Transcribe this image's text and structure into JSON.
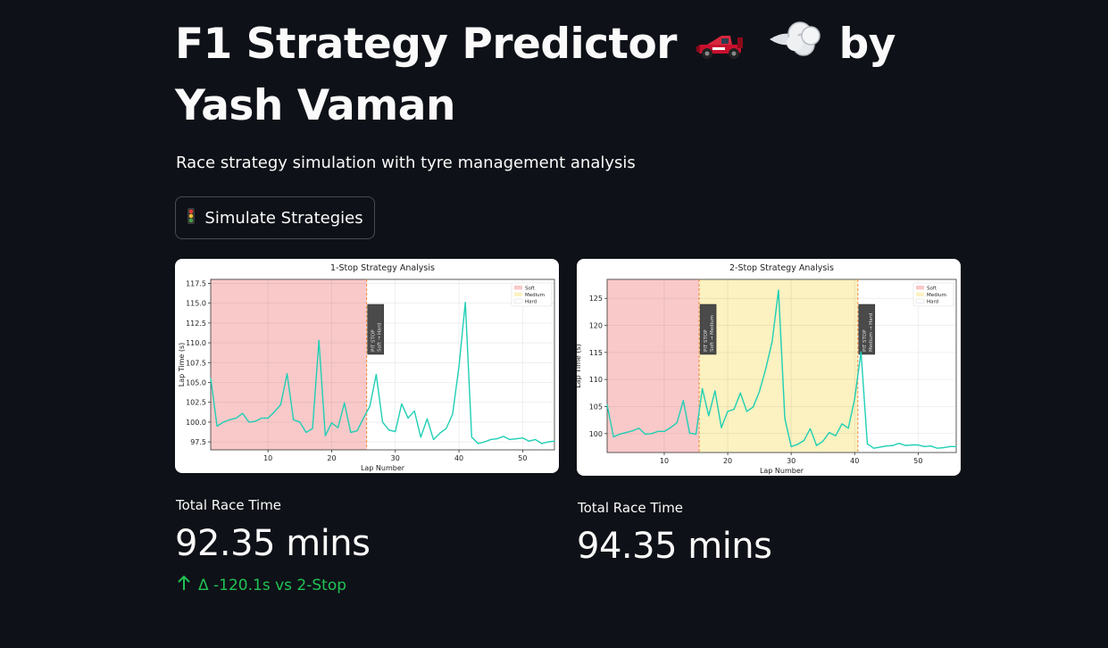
{
  "header": {
    "title_part1": "F1 Strategy Predictor",
    "title_part2": "by Yash Vaman",
    "icons": [
      "race-car-icon",
      "dashing-puff-icon"
    ],
    "subtitle": "Race strategy simulation with tyre management analysis"
  },
  "button": {
    "icon": "traffic-light-icon",
    "label": "Simulate Strategies"
  },
  "charts": [
    {
      "title": "1-Stop Strategy Analysis",
      "xlabel": "Lap Number",
      "ylabel": "Lap Time (s)",
      "xticks": [
        "10",
        "20",
        "30",
        "40",
        "50"
      ],
      "yticks": [
        "97.5",
        "100.0",
        "102.5",
        "105.0",
        "107.5",
        "110.0",
        "112.5",
        "115.0",
        "117.5"
      ],
      "legend": [
        "Soft",
        "Medium",
        "Hard"
      ],
      "annotations": [
        "PIT STOP",
        "Soft → Hard"
      ]
    },
    {
      "title": "2-Stop Strategy Analysis",
      "xlabel": "Lap Number",
      "ylabel": "Lap Time (s)",
      "xticks": [
        "10",
        "20",
        "30",
        "40",
        "50"
      ],
      "yticks": [
        "100",
        "105",
        "110",
        "115",
        "120",
        "125"
      ],
      "legend": [
        "Soft",
        "Medium",
        "Hard"
      ],
      "annotations": [
        "PIT STOP",
        "Soft → Medium",
        "PIT STOP",
        "Medium → Hard"
      ]
    }
  ],
  "metrics": [
    {
      "label": "Total Race Time",
      "value": "92.35 mins",
      "delta": "Δ -120.1s vs 2-Stop"
    },
    {
      "label": "Total Race Time",
      "value": "94.35 mins"
    }
  ],
  "colors": {
    "line": "#1fcfb4",
    "soft": "#f9c9c9",
    "medium": "#fbf1c1",
    "pit": "#f08a3c",
    "delta": "#21c354"
  },
  "chart_data": [
    {
      "type": "line",
      "title": "1-Stop Strategy Analysis",
      "xlabel": "Lap Number",
      "ylabel": "Lap Time (s)",
      "xlim": [
        1,
        55
      ],
      "ylim": [
        96.5,
        118
      ],
      "shaded": [
        {
          "name": "Soft",
          "from": 1,
          "to": 25.5
        }
      ],
      "pit_stops": [
        {
          "lap": 25.5,
          "text": "PIT STOP\nSoft → Hard"
        }
      ],
      "series": [
        {
          "x": [
            1,
            2,
            3,
            4,
            5,
            6,
            7,
            8,
            9,
            10,
            11,
            12,
            13,
            14,
            15,
            16,
            17,
            18,
            19,
            20,
            21,
            22,
            23,
            24,
            25,
            26,
            27,
            28,
            29,
            30,
            31,
            32,
            33,
            34,
            35,
            36,
            37,
            38,
            39,
            40,
            41,
            42,
            43,
            44,
            45,
            46,
            47,
            48,
            49,
            50,
            51,
            52,
            53,
            54,
            55
          ],
          "values": [
            105.5,
            99.5,
            100.0,
            100.3,
            100.5,
            101.1,
            100.0,
            100.1,
            100.5,
            100.5,
            101.3,
            102.2,
            106.1,
            100.3,
            100.0,
            98.7,
            99.2,
            110.3,
            98.3,
            99.9,
            99.3,
            102.4,
            98.7,
            98.9,
            100.5,
            102.0,
            106.0,
            100.0,
            99.0,
            98.8,
            102.3,
            100.5,
            101.4,
            98.1,
            100.4,
            97.8,
            98.6,
            99.2,
            101.0,
            107.0,
            115.1,
            98.1,
            97.3,
            97.5,
            97.8,
            97.9,
            98.2,
            97.8,
            97.9,
            98.0,
            97.6,
            97.8,
            97.3,
            97.5,
            97.6
          ]
        }
      ]
    },
    {
      "type": "line",
      "title": "2-Stop Strategy Analysis",
      "xlabel": "Lap Number",
      "ylabel": "Lap Time (s)",
      "xlim": [
        1,
        56
      ],
      "ylim": [
        96.5,
        128.5
      ],
      "shaded": [
        {
          "name": "Soft",
          "from": 1,
          "to": 15.5
        },
        {
          "name": "Medium",
          "from": 15.5,
          "to": 40.5
        }
      ],
      "pit_stops": [
        {
          "lap": 15.5,
          "text": "PIT STOP\nSoft → Medium"
        },
        {
          "lap": 40.5,
          "text": "PIT STOP\nMedium → Hard"
        }
      ],
      "series": [
        {
          "x": [
            1,
            2,
            3,
            4,
            5,
            6,
            7,
            8,
            9,
            10,
            11,
            12,
            13,
            14,
            15,
            16,
            17,
            18,
            19,
            20,
            21,
            22,
            23,
            24,
            25,
            26,
            27,
            28,
            29,
            30,
            31,
            32,
            33,
            34,
            35,
            36,
            37,
            38,
            39,
            40,
            41,
            42,
            43,
            44,
            45,
            46,
            47,
            48,
            49,
            50,
            51,
            52,
            53,
            54,
            55,
            56
          ],
          "values": [
            105.3,
            99.4,
            99.9,
            100.2,
            100.5,
            101.0,
            99.9,
            100.0,
            100.4,
            100.4,
            101.1,
            102.0,
            106.1,
            100.1,
            99.9,
            108.3,
            103.3,
            107.9,
            101.1,
            104.1,
            104.5,
            107.5,
            104.1,
            104.9,
            107.8,
            112.0,
            117.0,
            126.5,
            102.8,
            97.6,
            98.0,
            98.7,
            100.9,
            97.8,
            98.6,
            100.2,
            99.6,
            101.8,
            101.0,
            106.4,
            115.1,
            98.1,
            97.3,
            97.5,
            97.7,
            97.8,
            98.2,
            97.8,
            97.9,
            97.9,
            97.6,
            97.7,
            97.3,
            97.4,
            97.6,
            97.6
          ]
        }
      ]
    }
  ]
}
